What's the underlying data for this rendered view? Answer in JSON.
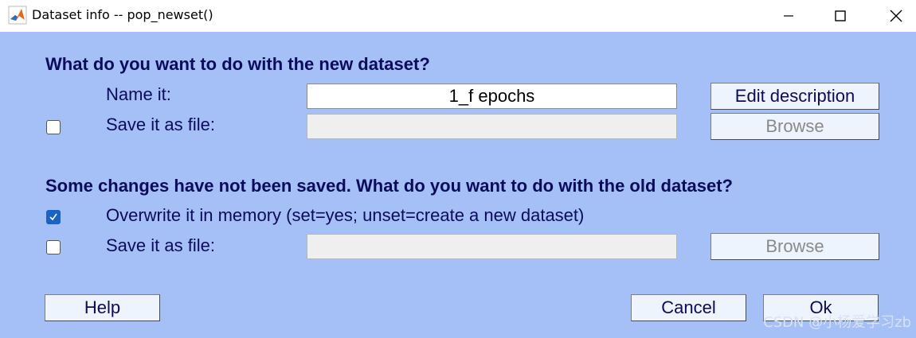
{
  "window": {
    "title": "Dataset info -- pop_newset()",
    "icons": {
      "app": "matlab-icon",
      "minimize": "minimize-icon",
      "maximize": "maximize-icon",
      "close": "close-icon"
    }
  },
  "new_dataset": {
    "heading": "What do you want to do with the new dataset?",
    "name_label": "Name it:",
    "name_value": "1_f epochs",
    "edit_description_label": "Edit description",
    "save_label": "Save it as file:",
    "save_checked": false,
    "save_path": "",
    "browse_label": "Browse"
  },
  "old_dataset": {
    "heading": "Some changes have not been saved. What do you want to do with the old dataset?",
    "overwrite_label": "Overwrite it in memory (set=yes; unset=create a new dataset)",
    "overwrite_checked": true,
    "save_label": "Save it as file:",
    "save_checked": false,
    "save_path": "",
    "browse_label": "Browse"
  },
  "buttons": {
    "help": "Help",
    "cancel": "Cancel",
    "ok": "Ok"
  },
  "watermark": "CSDN @小杨爱学习zb",
  "colors": {
    "background": "#a5bff7",
    "text": "#0b0b5c",
    "checkbox_checked": "#1a62c4",
    "button": "#eef4fd"
  }
}
